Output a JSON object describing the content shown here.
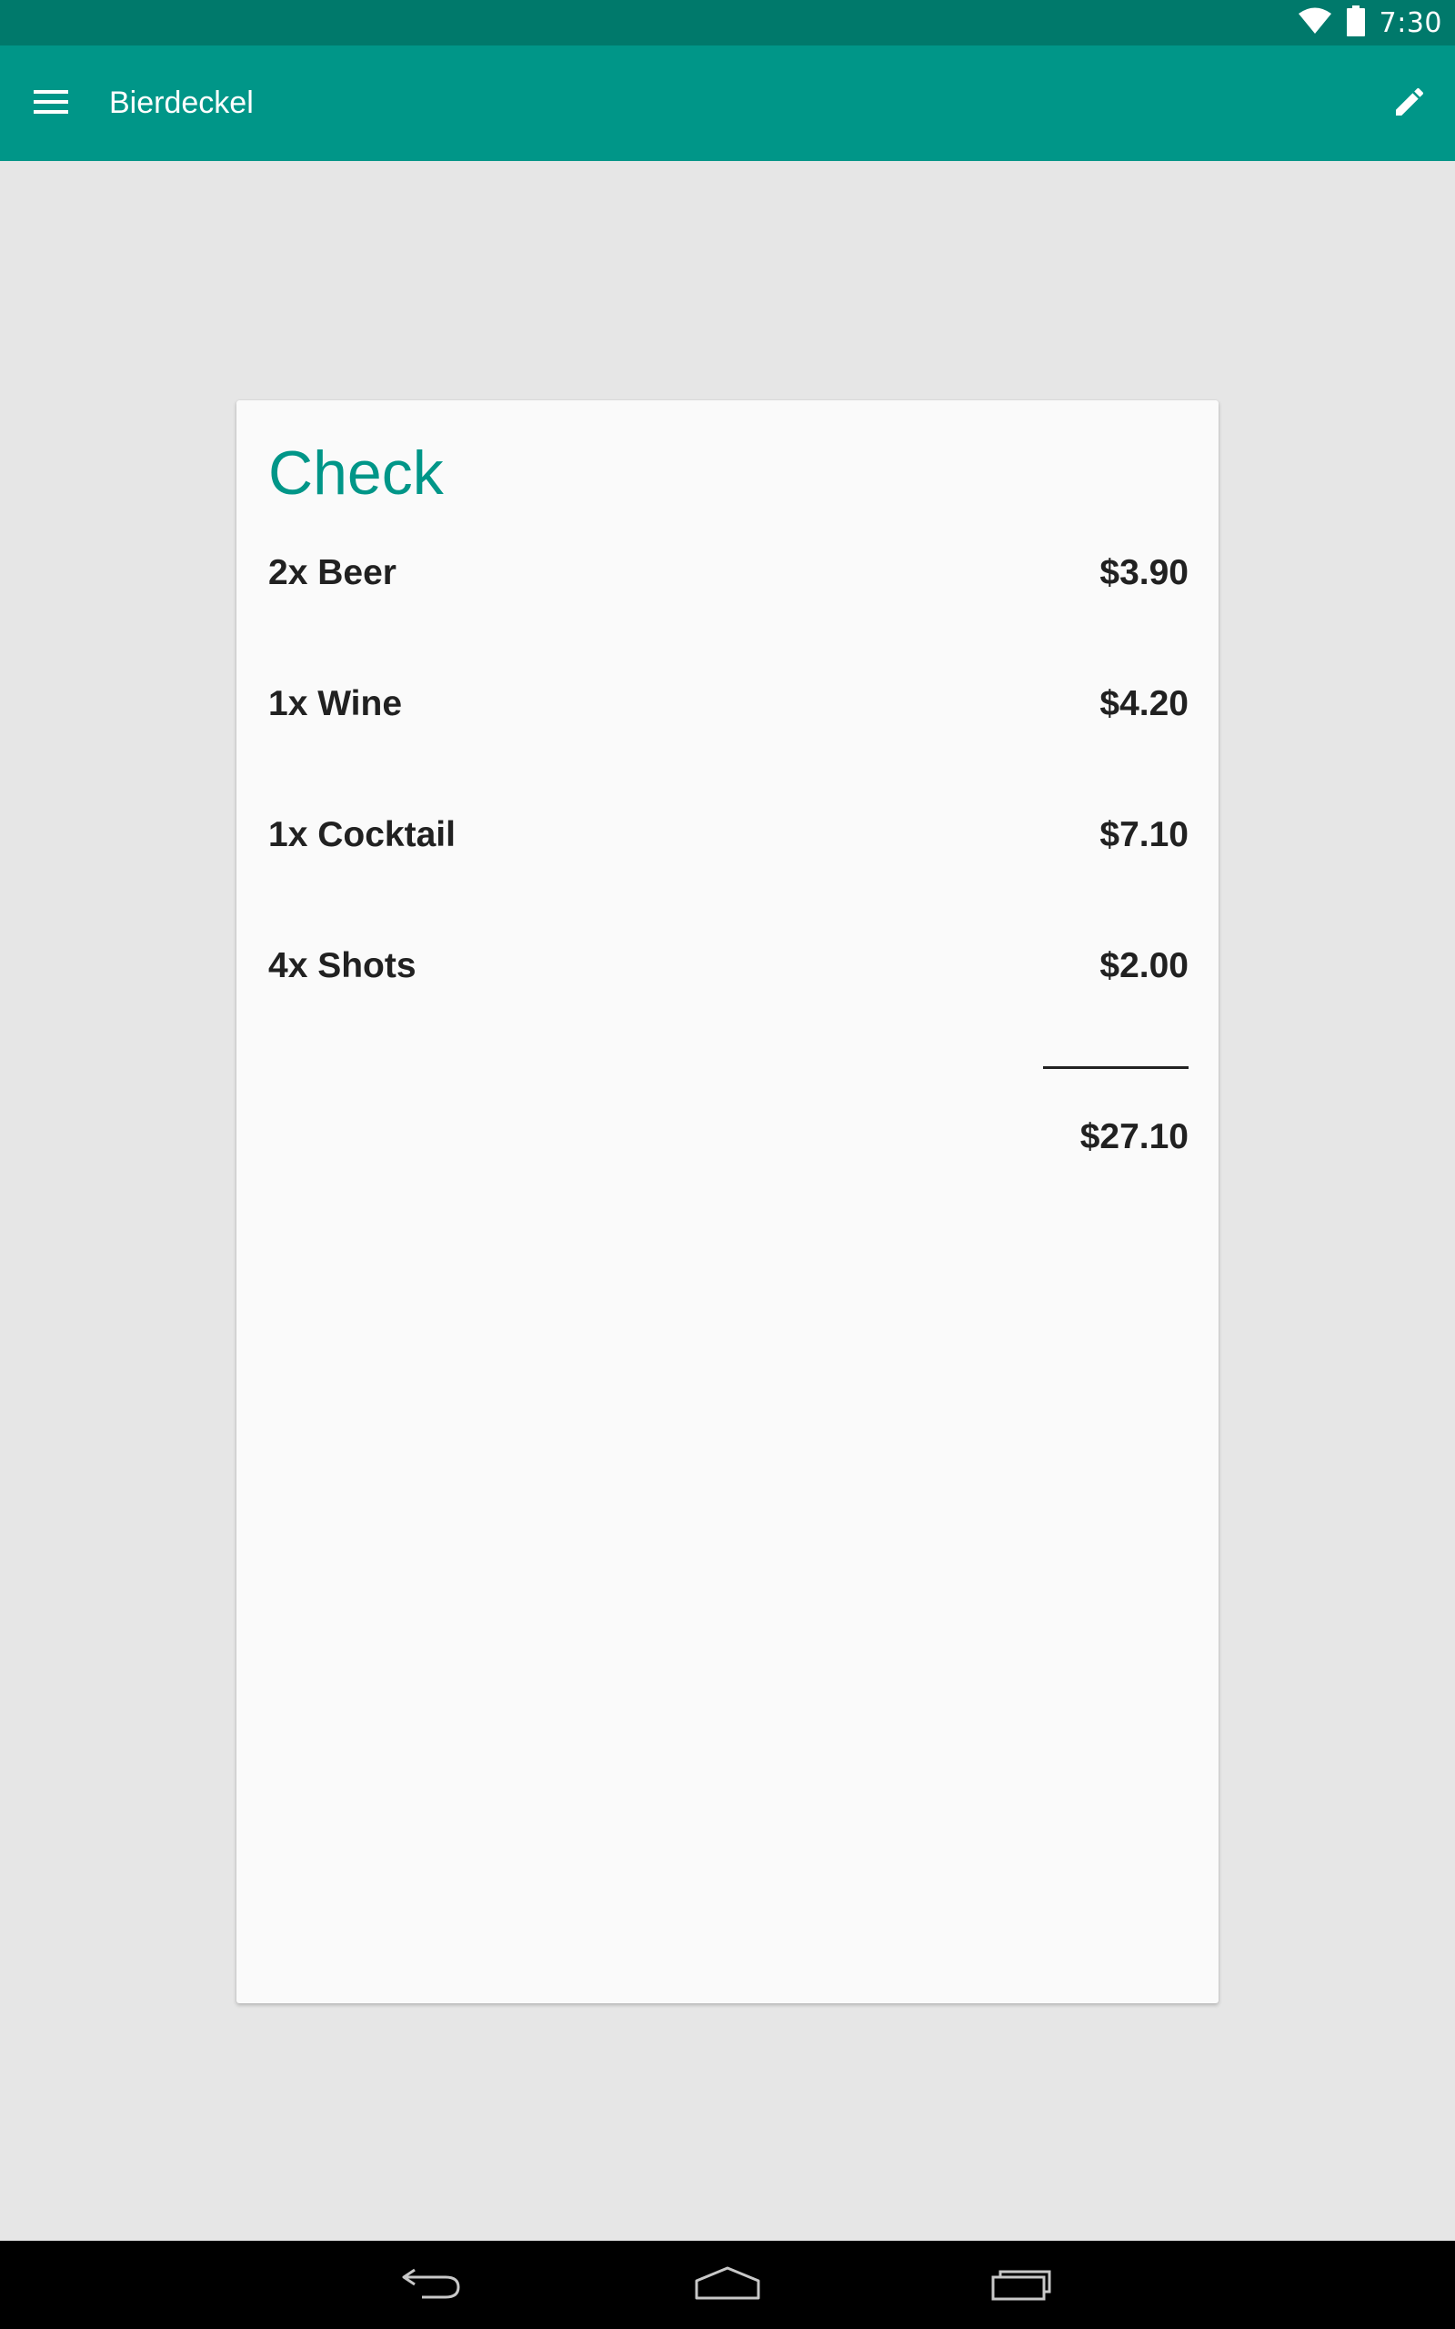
{
  "status_bar": {
    "time": "7:30",
    "icons": [
      "wifi-icon",
      "battery-icon"
    ]
  },
  "app_bar": {
    "title": "Bierdeckel",
    "menu_icon": "menu-icon",
    "edit_icon": "pencil-icon"
  },
  "check": {
    "title": "Check",
    "items": [
      {
        "label": "2x Beer",
        "price": "$3.90"
      },
      {
        "label": "1x Wine",
        "price": "$4.20"
      },
      {
        "label": "1x Cocktail",
        "price": "$7.10"
      },
      {
        "label": "4x Shots",
        "price": "$2.00"
      }
    ],
    "total": "$27.10"
  },
  "nav_bar": {
    "icons": [
      "back-icon",
      "home-icon",
      "recents-icon"
    ]
  },
  "colors": {
    "status_bar": "#00796b",
    "app_bar": "#009688",
    "accent": "#009688",
    "background": "#e6e6e6",
    "card": "#fafafa",
    "text": "#212121"
  }
}
